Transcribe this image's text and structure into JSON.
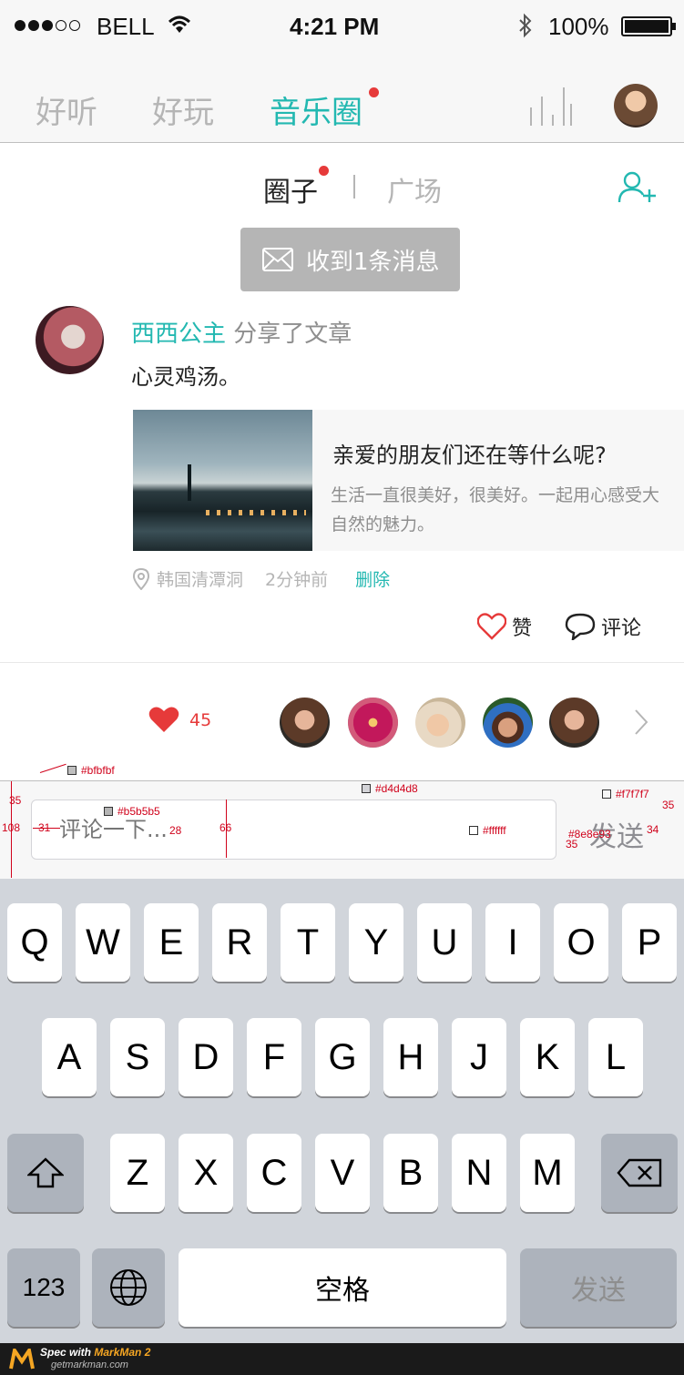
{
  "status_bar": {
    "carrier": "BELL",
    "time": "4:21 PM",
    "battery": "100%"
  },
  "top_nav": {
    "tabs": [
      {
        "label": "好听",
        "active": false
      },
      {
        "label": "好玩",
        "active": false
      },
      {
        "label": "音乐圈",
        "active": true,
        "badge": true
      }
    ]
  },
  "sub_tabs": {
    "circle": "圈子",
    "square": "广场"
  },
  "message_pill": {
    "label": "收到1条消息"
  },
  "post": {
    "user": "西西公主",
    "action": "分享了文章",
    "text": "心灵鸡汤。",
    "article": {
      "title": "亲爱的朋友们还在等什么呢?",
      "desc": "生活一直很美好，很美好。一起用心感受大自然的魅力。"
    },
    "location": "韩国清潭洞",
    "time": "2分钟前",
    "delete_label": "删除",
    "like_label": "赞",
    "comment_label": "评论"
  },
  "likes": {
    "count": "45"
  },
  "comment_bar": {
    "placeholder": "评论一下...",
    "send_label": "发送"
  },
  "annotations": {
    "c1": "#bfbfbf",
    "c2": "#d4d4d8",
    "c3": "#f7f7f7",
    "c4": "#b5b5b5",
    "c5": "#ffffff",
    "c6": "#8e8e93",
    "m35a": "35",
    "m108": "108",
    "m31": "31",
    "m28": "28",
    "m66": "66",
    "m35b": "35",
    "m35c": "35",
    "m34": "34"
  },
  "keyboard": {
    "row1": [
      "Q",
      "W",
      "E",
      "R",
      "T",
      "Y",
      "U",
      "I",
      "O",
      "P"
    ],
    "row2": [
      "A",
      "S",
      "D",
      "F",
      "G",
      "H",
      "J",
      "K",
      "L"
    ],
    "row3": [
      "Z",
      "X",
      "C",
      "V",
      "B",
      "N",
      "M"
    ],
    "num_label": "123",
    "space_label": "空格",
    "send_label": "发送"
  },
  "footer": {
    "spec": "Spec with",
    "app": "MarkMan 2",
    "domain": "getmarkman.com"
  },
  "colors": {
    "accent": "#23b8b1",
    "like_red": "#e63a3a",
    "inactive": "#b5b5b5"
  }
}
